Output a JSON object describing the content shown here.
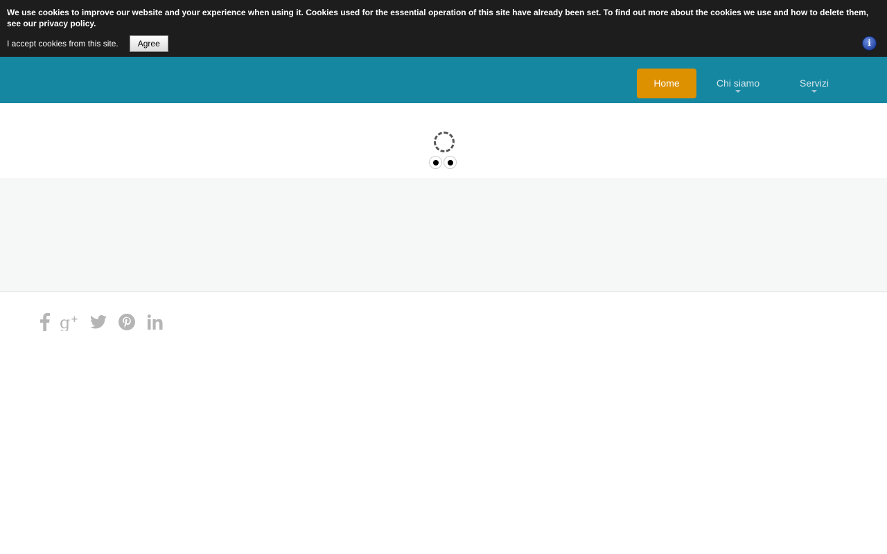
{
  "cookie_bar": {
    "message": "We use cookies to improve our website and your experience when using it. Cookies used for the essential operation of this site have already been set. To find out more about the cookies we use and how to delete them, see our privacy policy.",
    "accept_text": "I accept cookies from this site.",
    "agree_label": "Agree",
    "info_icon": "info-icon",
    "info_glyph": "i"
  },
  "nav": {
    "items": [
      {
        "label": "Home",
        "active": true
      },
      {
        "label": "Chi siamo",
        "has_submenu": true
      },
      {
        "label": "Servizi",
        "has_submenu": true
      }
    ],
    "bar_color": "#1687a1",
    "active_color": "#dd9000"
  },
  "slider": {
    "loading_icon": "spinner-icon",
    "dots": 2
  },
  "social": {
    "icons": [
      "facebook-icon",
      "google-plus-icon",
      "twitter-icon",
      "pinterest-icon",
      "linkedin-icon"
    ],
    "color": "#b5b5b5"
  }
}
